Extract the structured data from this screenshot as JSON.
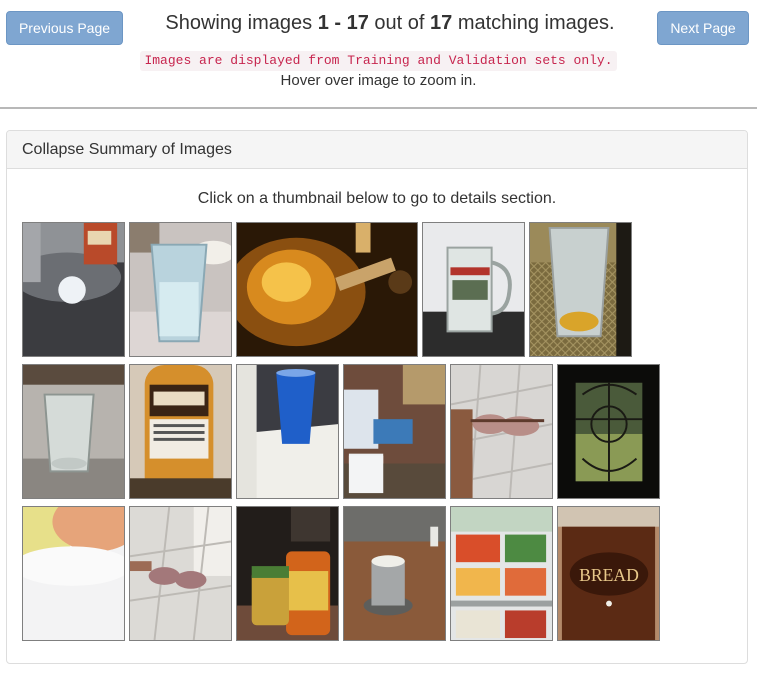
{
  "nav": {
    "previous_label": "Previous Page",
    "next_label": "Next Page"
  },
  "summary": {
    "prefix": "Showing images ",
    "range_start": "1",
    "range_sep": " - ",
    "range_end": "17",
    "middle": " out of ",
    "total": "17",
    "suffix": " matching images.",
    "notice": "Images are displayed from Training and Validation sets only.",
    "hint": "Hover over image to zoom in."
  },
  "panel": {
    "title": "Collapse Summary of Images",
    "intro": "Click on a thumbnail below to go to details section."
  },
  "thumbnails": {
    "t1": {
      "subject": "hot sauce bottle on dark table"
    },
    "t2": {
      "subject": "clear glass of water"
    },
    "t3": {
      "subject": "glass with amber liquid in dim light"
    },
    "t4": {
      "subject": "glass beer mug with logo"
    },
    "t5": {
      "subject": "beer glass on wicker mat"
    },
    "t6": {
      "subject": "small clear glass on counter"
    },
    "t7": {
      "subject": "caramel sauce bottle"
    },
    "t8": {
      "subject": "blue cup on white cabinet"
    },
    "t9": {
      "subject": "white cup on cluttered couch"
    },
    "t10": {
      "subject": "hand holding sunglasses over tile floor"
    },
    "t11": {
      "subject": "dark window with leaded glass"
    },
    "t12": {
      "subject": "blurry bright light"
    },
    "t13": {
      "subject": "sunglasses over tile floor"
    },
    "t14": {
      "subject": "jars on cluttered table"
    },
    "t15": {
      "subject": "steel cup on wooden table"
    },
    "t16": {
      "subject": "supermarket freezer shelves"
    },
    "t17": {
      "subject": "wooden bread box"
    }
  },
  "bread_box_text": "BREAD"
}
